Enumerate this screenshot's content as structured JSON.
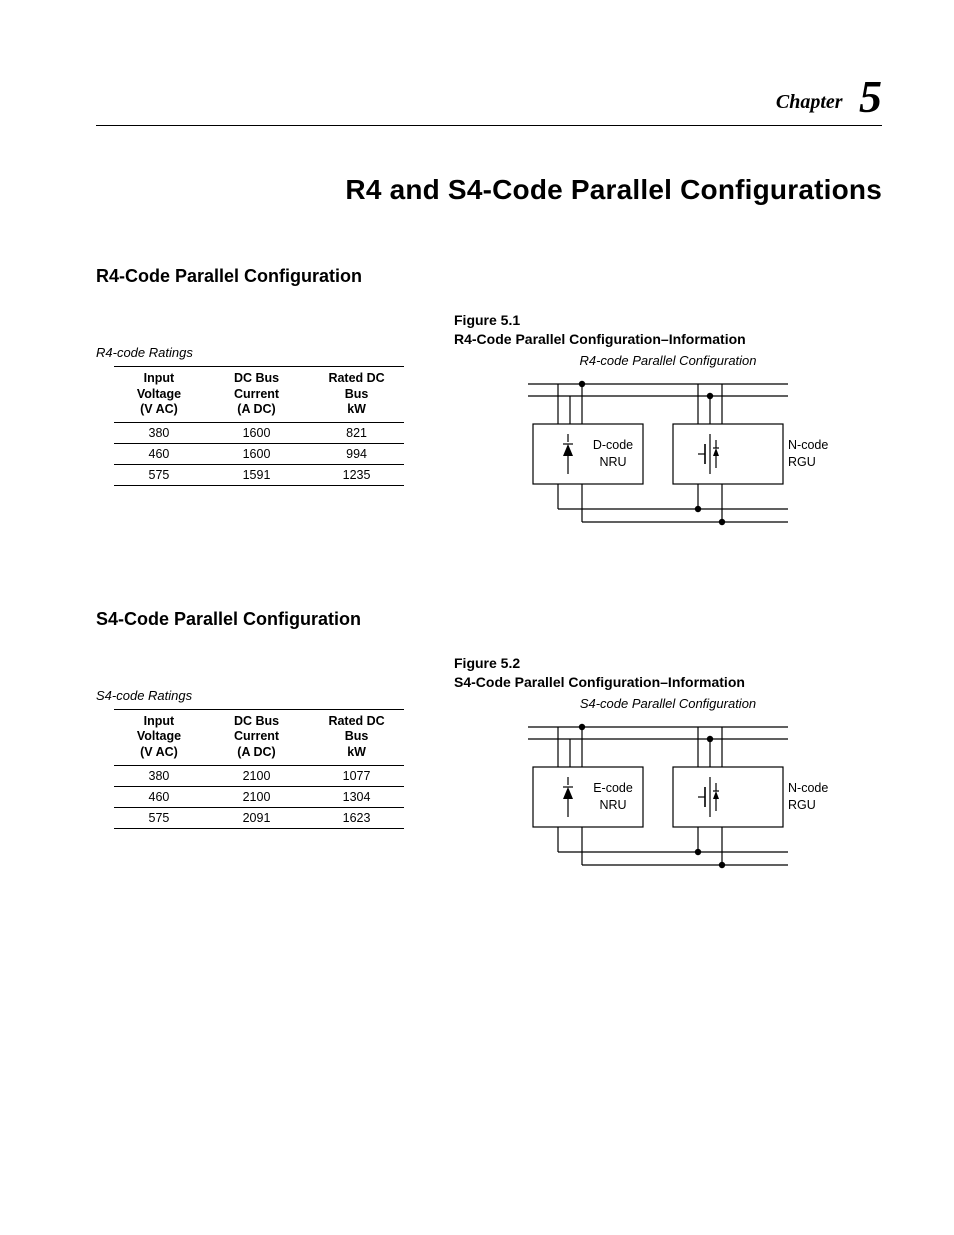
{
  "chapter": {
    "label": "Chapter",
    "number": "5"
  },
  "page_title": "R4 and S4-Code Parallel Configurations",
  "sections": [
    {
      "heading": "R4-Code Parallel Configuration",
      "ratings_label": "R4-code Ratings",
      "figure_label": "Figure 5.1",
      "figure_title": "R4-Code Parallel Configuration–Information",
      "config_subtitle": "R4-code Parallel Configuration",
      "table": {
        "headers": [
          {
            "l1": "Input Voltage",
            "l2": "(V AC)"
          },
          {
            "l1": "DC Bus Current",
            "l2": "(A DC)"
          },
          {
            "l1": "Rated DC Bus",
            "l2": "kW"
          }
        ],
        "rows": [
          [
            "380",
            "1600",
            "821"
          ],
          [
            "460",
            "1600",
            "994"
          ],
          [
            "575",
            "1591",
            "1235"
          ]
        ]
      },
      "diagram": {
        "box1": {
          "l1": "D-code",
          "l2": "NRU"
        },
        "box2": {
          "l1": "N-code",
          "l2": "RGU"
        }
      }
    },
    {
      "heading": "S4-Code Parallel Configuration",
      "ratings_label": "S4-code Ratings",
      "figure_label": "Figure 5.2",
      "figure_title": "S4-Code Parallel Configuration–Information",
      "config_subtitle": "S4-code Parallel Configuration",
      "table": {
        "headers": [
          {
            "l1": "Input Voltage",
            "l2": "(V AC)"
          },
          {
            "l1": "DC Bus Current",
            "l2": "(A DC)"
          },
          {
            "l1": "Rated DC Bus",
            "l2": "kW"
          }
        ],
        "rows": [
          [
            "380",
            "2100",
            "1077"
          ],
          [
            "460",
            "2100",
            "1304"
          ],
          [
            "575",
            "2091",
            "1623"
          ]
        ]
      },
      "diagram": {
        "box1": {
          "l1": "E-code",
          "l2": "NRU"
        },
        "box2": {
          "l1": "N-code",
          "l2": "RGU"
        }
      }
    }
  ]
}
